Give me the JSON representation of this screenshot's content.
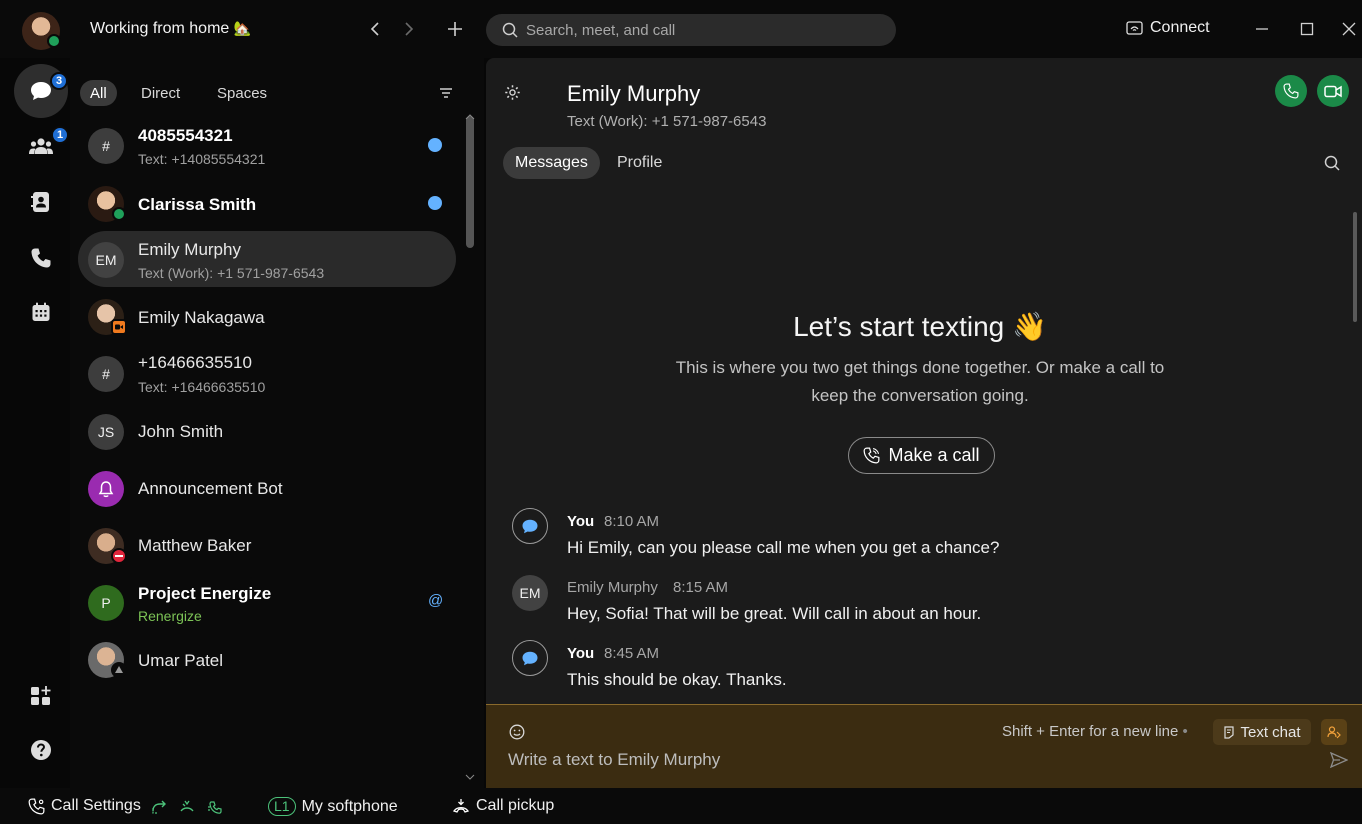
{
  "header": {
    "status_title": "Working from home",
    "status_emoji": "🏡",
    "search_placeholder": "Search, meet, and call",
    "connect_label": "Connect"
  },
  "rail": {
    "messaging_badge": "3",
    "teams_badge": "1"
  },
  "filters": {
    "all": "All",
    "direct": "Direct",
    "spaces": "Spaces"
  },
  "contacts": [
    {
      "name": "4085554321",
      "sub": "Text: +14085554321",
      "avatar": "#"
    },
    {
      "name": "Clarissa Smith"
    },
    {
      "name": "Emily Murphy",
      "sub": "Text (Work): +1 571-987-6543",
      "avatar": "EM"
    },
    {
      "name": "Emily Nakagawa"
    },
    {
      "name": "+16466635510",
      "sub": "Text: +16466635510",
      "avatar": "#"
    },
    {
      "name": "John Smith",
      "avatar": "JS"
    },
    {
      "name": "Announcement Bot"
    },
    {
      "name": "Matthew Baker"
    },
    {
      "name": "Project Energize",
      "sub": "Renergize",
      "avatar": "P",
      "mention": "@"
    },
    {
      "name": "Umar Patel"
    }
  ],
  "conversation": {
    "name": "Emily Murphy",
    "sub": "Text (Work): +1 571-987-6543",
    "tabs": {
      "messages": "Messages",
      "profile": "Profile"
    },
    "empty_title": "Let’s start texting",
    "empty_emoji": "👋",
    "empty_line1": "This is where you two get things done together. Or make a call to",
    "empty_line2": "keep the conversation going.",
    "make_call": "Make a call",
    "messages": [
      {
        "sender": "You",
        "time": "8:10 AM",
        "text": "Hi Emily, can you please call me when you get a chance?"
      },
      {
        "sender": "Emily Murphy",
        "time": "8:15 AM",
        "text": "Hey, Sofia! That will be great. Will call in about an hour.",
        "avatar": "EM"
      },
      {
        "sender": "You",
        "time": "8:45 AM",
        "text": "This should be okay. Thanks."
      }
    ]
  },
  "composer": {
    "hint": "Shift + Enter for a new line",
    "dot": "•",
    "text_chat": "Text chat",
    "placeholder": "Write a text to Emily Murphy"
  },
  "footer": {
    "call_settings": "Call Settings",
    "line_badge": "L1",
    "softphone": "My softphone",
    "call_pickup": "Call pickup"
  },
  "colors": {
    "accent_green": "#1b8a48",
    "unread_blue": "#64b2ff",
    "badge_blue": "#1f6fd6",
    "composer_bg": "#3b2c11"
  }
}
